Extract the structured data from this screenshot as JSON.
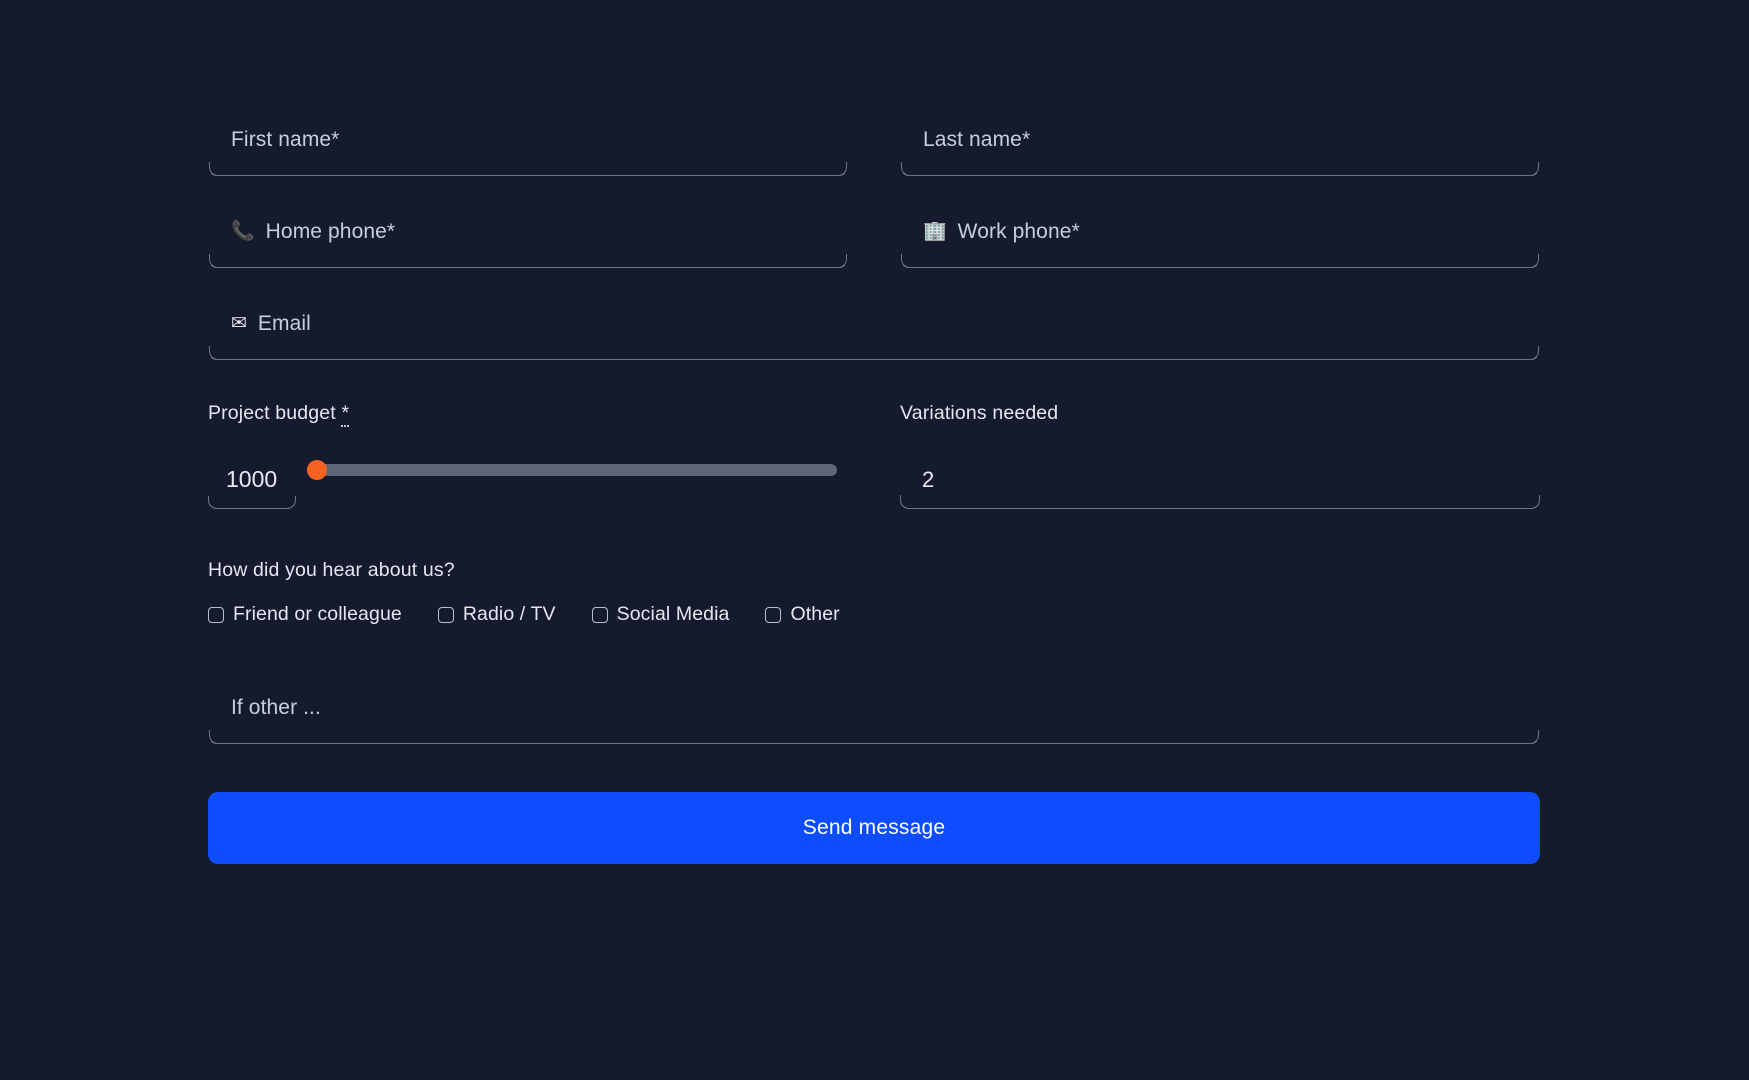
{
  "theme": {
    "background": "#161a2e",
    "field_underline": "#6d7285",
    "text_primary": "#e4e7f0",
    "placeholder": "#c9cede",
    "accent_button": "#0d4dfd",
    "slider_thumb": "#f26322",
    "slider_track": "#60657a",
    "checkbox_border": "#b9bfd0"
  },
  "form": {
    "fields": {
      "first_name": {
        "placeholder": "First name*",
        "value": "",
        "icon": ""
      },
      "last_name": {
        "placeholder": "Last name*",
        "value": "",
        "icon": ""
      },
      "home_phone": {
        "placeholder": "Home phone*",
        "value": "",
        "icon": "📞"
      },
      "work_phone": {
        "placeholder": "Work phone*",
        "value": "",
        "icon": "🏢"
      },
      "email": {
        "placeholder": "Email",
        "value": "",
        "icon": "✉"
      },
      "if_other": {
        "placeholder": "If other ...",
        "value": "",
        "icon": ""
      }
    },
    "budget": {
      "label": "Project budget",
      "required_mark": "*",
      "value": "1000",
      "slider_min": 1000,
      "slider_max": 100000,
      "slider_percent": 0
    },
    "variations": {
      "label": "Variations needed",
      "value": "2"
    },
    "hear_about": {
      "question": "How did you hear about us?",
      "options": [
        {
          "label": "Friend or colleague",
          "checked": false
        },
        {
          "label": "Radio / TV",
          "checked": false
        },
        {
          "label": "Social Media",
          "checked": false
        },
        {
          "label": "Other",
          "checked": false
        }
      ]
    },
    "submit": {
      "label": "Send message"
    }
  }
}
